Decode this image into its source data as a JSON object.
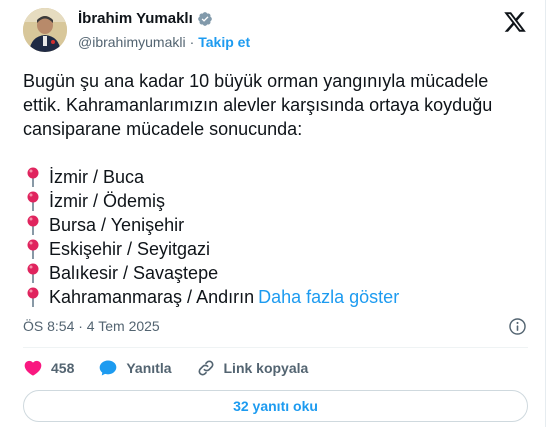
{
  "author": {
    "name": "İbrahim Yumaklı",
    "handle": "@ibrahimyumakli",
    "separator": "·",
    "follow_label": "Takip et"
  },
  "icons": {
    "verified": "verified-badge-icon",
    "x_logo": "x-logo-icon",
    "pin": "round-pushpin-icon",
    "info": "info-icon",
    "like": "heart-icon",
    "reply": "speech-bubble-icon",
    "link": "link-icon"
  },
  "colors": {
    "accent": "#1d9bf0",
    "like_red": "#f91880",
    "pin_red": "#e0245e",
    "secondary_text": "#536471"
  },
  "tweet": {
    "text_lines": [
      "Bugün şu ana kadar 10 büyük orman yangınıyla mücadele",
      "ettik. Kahramanlarımızın alevler karşısında ortaya koyduğu",
      "cansiparane mücadele sonucunda:"
    ],
    "locations": [
      "İzmir / Buca",
      "İzmir / Ödemiş",
      "Bursa / Yenişehir",
      "Eskişehir / Seyitgazi",
      "Balıkesir / Savaştepe",
      "Kahramanmaraş / Andırın"
    ],
    "show_more": "Daha fazla göster",
    "timestamp": "ÖS 8:54 · 4 Tem 2025"
  },
  "actions": {
    "likes_count": "458",
    "reply_label": "Yanıtla",
    "copy_link_label": "Link kopyala"
  },
  "read_replies": "32 yanıtı oku"
}
